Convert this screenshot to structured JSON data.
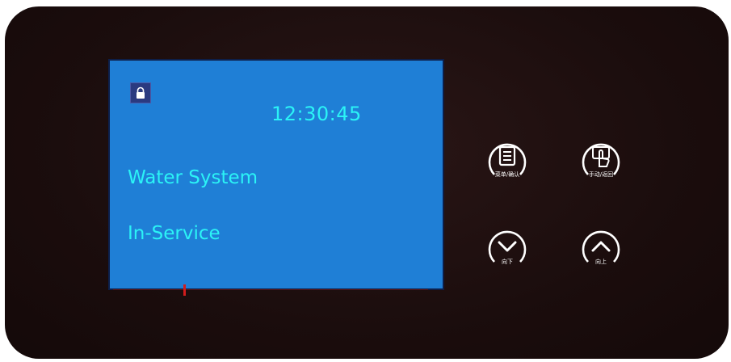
{
  "display": {
    "time": "12:30:45",
    "line1": "Water System",
    "line2": "In-Service",
    "lock_icon": "lock-icon"
  },
  "buttons": {
    "menu": {
      "icon": "menu-list-icon",
      "label": "菜单/确认"
    },
    "manual": {
      "icon": "hand-touch-icon",
      "label": "手动/返回"
    },
    "down": {
      "icon": "chevron-down-icon",
      "label": "向下"
    },
    "up": {
      "icon": "chevron-up-icon",
      "label": "向上"
    }
  },
  "colors": {
    "screen": "#1f7fd6",
    "screen_text": "#2bf3f6",
    "panel": "#1b0d0d",
    "marker": "#d11c1c"
  }
}
